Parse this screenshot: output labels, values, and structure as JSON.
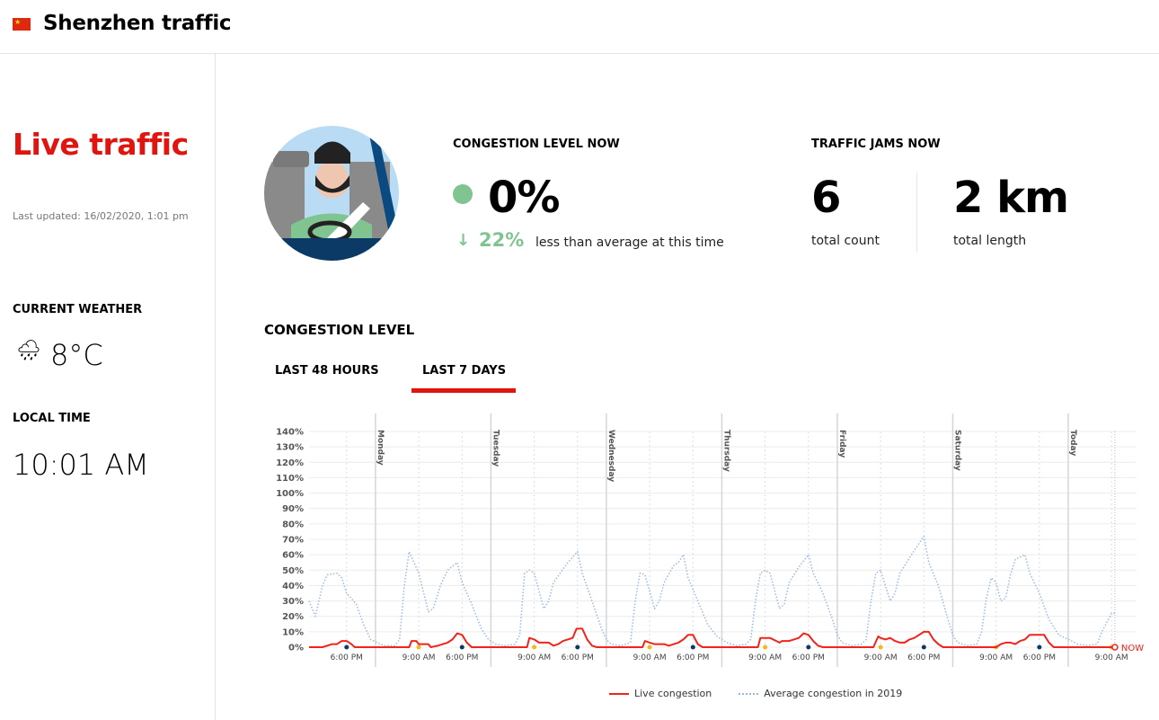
{
  "header": {
    "title": "Shenzhen traffic",
    "flag": "china-flag"
  },
  "sidebar": {
    "live_title": "Live traffic",
    "last_updated": "Last updated: 16/02/2020, 1:01 pm",
    "weather_heading": "CURRENT WEATHER",
    "weather_icon": "rain-cloud-icon",
    "temperature": "8°C",
    "time_heading": "LOCAL TIME",
    "local_time": "10:01 AM"
  },
  "congestion_now": {
    "heading": "CONGESTION LEVEL NOW",
    "value": "0%",
    "status_color": "#7fc491",
    "change": "22%",
    "change_text": "less than average at this time"
  },
  "jams_now": {
    "heading": "TRAFFIC JAMS NOW",
    "count": "6",
    "count_label": "total count",
    "length": "2 km",
    "length_label": "total length"
  },
  "chart_section": {
    "heading": "CONGESTION LEVEL",
    "tabs": [
      {
        "label": "LAST 48 HOURS",
        "active": false
      },
      {
        "label": "LAST 7 DAYS",
        "active": true
      }
    ],
    "accent": "#e0150f"
  },
  "chart_data": {
    "type": "line",
    "x_unit": "hours since Sunday 00:00",
    "xlim": [
      10.2,
      182.2
    ],
    "ylim": [
      0,
      140
    ],
    "yticks": [
      0,
      10,
      20,
      30,
      40,
      50,
      60,
      70,
      80,
      90,
      100,
      110,
      120,
      130,
      140
    ],
    "ytick_labels": [
      "0%",
      "10%",
      "20%",
      "30%",
      "40%",
      "50%",
      "60%",
      "70%",
      "80%",
      "90%",
      "100%",
      "110%",
      "120%",
      "130%",
      "140%"
    ],
    "day_markers": [
      {
        "label": "Monday",
        "x": 24
      },
      {
        "label": "Tuesday",
        "x": 48
      },
      {
        "label": "Wednesday",
        "x": 72
      },
      {
        "label": "Thursday",
        "x": 96
      },
      {
        "label": "Friday",
        "x": 120
      },
      {
        "label": "Saturday",
        "x": 144
      },
      {
        "label": "Today",
        "x": 168
      }
    ],
    "xticks": [
      {
        "label": "6:00 PM",
        "x": 18,
        "dot": "#0b3a66"
      },
      {
        "label": "9:00 AM",
        "x": 33,
        "dot": "#f5b81a"
      },
      {
        "label": "6:00 PM",
        "x": 42,
        "dot": "#0b3a66"
      },
      {
        "label": "9:00 AM",
        "x": 57,
        "dot": "#f5b81a"
      },
      {
        "label": "6:00 PM",
        "x": 66,
        "dot": "#0b3a66"
      },
      {
        "label": "9:00 AM",
        "x": 81,
        "dot": "#f5b81a"
      },
      {
        "label": "6:00 PM",
        "x": 90,
        "dot": "#0b3a66"
      },
      {
        "label": "9:00 AM",
        "x": 105,
        "dot": "#f5b81a"
      },
      {
        "label": "6:00 PM",
        "x": 114,
        "dot": "#0b3a66"
      },
      {
        "label": "9:00 AM",
        "x": 129,
        "dot": "#f5b81a"
      },
      {
        "label": "6:00 PM",
        "x": 138,
        "dot": "#0b3a66"
      },
      {
        "label": "9:00 AM",
        "x": 153,
        "dot": "#f5b81a"
      },
      {
        "label": "6:00 PM",
        "x": 162,
        "dot": "#0b3a66"
      },
      {
        "label": "9:00 AM",
        "x": 177,
        "dot": "#f5b81a"
      }
    ],
    "now": {
      "label": "NOW",
      "x": 177.7,
      "y": 0
    },
    "series": [
      {
        "name": "Live congestion",
        "color": "#f2231b",
        "style": "solid",
        "points": [
          [
            10.2,
            0
          ],
          [
            13,
            0
          ],
          [
            15,
            2
          ],
          [
            16,
            2
          ],
          [
            17,
            4
          ],
          [
            18,
            4
          ],
          [
            19,
            2
          ],
          [
            19.7,
            0
          ],
          [
            31,
            0
          ],
          [
            31.5,
            4
          ],
          [
            32.5,
            4
          ],
          [
            33,
            2
          ],
          [
            35,
            2
          ],
          [
            35.5,
            0
          ],
          [
            37,
            1
          ],
          [
            39,
            3
          ],
          [
            40,
            5
          ],
          [
            41,
            9
          ],
          [
            42,
            8
          ],
          [
            43,
            3
          ],
          [
            44,
            0
          ],
          [
            55.5,
            0
          ],
          [
            56,
            6
          ],
          [
            57,
            5
          ],
          [
            58,
            3
          ],
          [
            60,
            3
          ],
          [
            61,
            1
          ],
          [
            62,
            2
          ],
          [
            63,
            4
          ],
          [
            65,
            6
          ],
          [
            65.8,
            12
          ],
          [
            67,
            12
          ],
          [
            68,
            5
          ],
          [
            69,
            1
          ],
          [
            70,
            0
          ],
          [
            79.5,
            0
          ],
          [
            80,
            4
          ],
          [
            81,
            3
          ],
          [
            82,
            2
          ],
          [
            84,
            2
          ],
          [
            85,
            1
          ],
          [
            87,
            3
          ],
          [
            88,
            5
          ],
          [
            89,
            8
          ],
          [
            90,
            8
          ],
          [
            91,
            2
          ],
          [
            92,
            0
          ],
          [
            103.5,
            0
          ],
          [
            104,
            6
          ],
          [
            106,
            6
          ],
          [
            108,
            3
          ],
          [
            108.5,
            4
          ],
          [
            110,
            4
          ],
          [
            112,
            6
          ],
          [
            113,
            9
          ],
          [
            114,
            8
          ],
          [
            115,
            4
          ],
          [
            116,
            1
          ],
          [
            117,
            0
          ],
          [
            127.5,
            0
          ],
          [
            128.5,
            7
          ],
          [
            129,
            6
          ],
          [
            130,
            5
          ],
          [
            131,
            6
          ],
          [
            132,
            4
          ],
          [
            133,
            3
          ],
          [
            134,
            3
          ],
          [
            135,
            5
          ],
          [
            136,
            6
          ],
          [
            137,
            8
          ],
          [
            138,
            10
          ],
          [
            139,
            10
          ],
          [
            140,
            5
          ],
          [
            141,
            2
          ],
          [
            142,
            0
          ],
          [
            153,
            0
          ],
          [
            154,
            2
          ],
          [
            155,
            3
          ],
          [
            156,
            3
          ],
          [
            157,
            2
          ],
          [
            158,
            4
          ],
          [
            159,
            5
          ],
          [
            160,
            8
          ],
          [
            161,
            8
          ],
          [
            162,
            8
          ],
          [
            163,
            8
          ],
          [
            164,
            3
          ],
          [
            165,
            0
          ],
          [
            177.7,
            0
          ]
        ]
      },
      {
        "name": "Average congestion in 2019",
        "color": "#9ab8e0",
        "style": "dotted",
        "points": [
          [
            10.2,
            30
          ],
          [
            11.5,
            20
          ],
          [
            13,
            40
          ],
          [
            14,
            47
          ],
          [
            16,
            48
          ],
          [
            17,
            45
          ],
          [
            18,
            35
          ],
          [
            20,
            28
          ],
          [
            21.5,
            15
          ],
          [
            23,
            5
          ],
          [
            25,
            2
          ],
          [
            26,
            1
          ],
          [
            28,
            1
          ],
          [
            29,
            5
          ],
          [
            30,
            40
          ],
          [
            31,
            62
          ],
          [
            33,
            48
          ],
          [
            35,
            23
          ],
          [
            36,
            25
          ],
          [
            37.5,
            40
          ],
          [
            39,
            50
          ],
          [
            41,
            55
          ],
          [
            42,
            42
          ],
          [
            44,
            28
          ],
          [
            46,
            12
          ],
          [
            47.5,
            5
          ],
          [
            49,
            2
          ],
          [
            51,
            1
          ],
          [
            53,
            2
          ],
          [
            54,
            8
          ],
          [
            55,
            48
          ],
          [
            56,
            50
          ],
          [
            57,
            48
          ],
          [
            59,
            25
          ],
          [
            60,
            30
          ],
          [
            61,
            42
          ],
          [
            64,
            55
          ],
          [
            66,
            62
          ],
          [
            67,
            48
          ],
          [
            69,
            30
          ],
          [
            71,
            12
          ],
          [
            72,
            5
          ],
          [
            73,
            2
          ],
          [
            75,
            1
          ],
          [
            77,
            3
          ],
          [
            78,
            30
          ],
          [
            79,
            48
          ],
          [
            80,
            47
          ],
          [
            82,
            25
          ],
          [
            83,
            30
          ],
          [
            84,
            42
          ],
          [
            86,
            53
          ],
          [
            87,
            55
          ],
          [
            88,
            60
          ],
          [
            89,
            45
          ],
          [
            91,
            30
          ],
          [
            93,
            15
          ],
          [
            95,
            7
          ],
          [
            97,
            3
          ],
          [
            99,
            1
          ],
          [
            101,
            2
          ],
          [
            102,
            5
          ],
          [
            103,
            30
          ],
          [
            104,
            48
          ],
          [
            105,
            50
          ],
          [
            106,
            48
          ],
          [
            108,
            25
          ],
          [
            109,
            28
          ],
          [
            110,
            42
          ],
          [
            112,
            52
          ],
          [
            114,
            60
          ],
          [
            115,
            48
          ],
          [
            117,
            35
          ],
          [
            119,
            18
          ],
          [
            120,
            8
          ],
          [
            121,
            3
          ],
          [
            123,
            1
          ],
          [
            125,
            2
          ],
          [
            126,
            5
          ],
          [
            127,
            30
          ],
          [
            128,
            48
          ],
          [
            129,
            50
          ],
          [
            131,
            30
          ],
          [
            132,
            35
          ],
          [
            133,
            48
          ],
          [
            135,
            58
          ],
          [
            138,
            72
          ],
          [
            139,
            55
          ],
          [
            141,
            40
          ],
          [
            143,
            18
          ],
          [
            144,
            8
          ],
          [
            145,
            3
          ],
          [
            147,
            1
          ],
          [
            149,
            2
          ],
          [
            150,
            10
          ],
          [
            151,
            32
          ],
          [
            152,
            45
          ],
          [
            153,
            42
          ],
          [
            154,
            30
          ],
          [
            155,
            32
          ],
          [
            156,
            47
          ],
          [
            157,
            57
          ],
          [
            159,
            60
          ],
          [
            160,
            48
          ],
          [
            162,
            35
          ],
          [
            164,
            18
          ],
          [
            166,
            8
          ],
          [
            168,
            5
          ],
          [
            170,
            2
          ],
          [
            172,
            1
          ],
          [
            174,
            2
          ],
          [
            175,
            10
          ],
          [
            177,
            22
          ],
          [
            177.7,
            22
          ]
        ]
      }
    ],
    "legend": [
      "Live congestion",
      "Average congestion in 2019"
    ],
    "legend_position": "bottom-center"
  }
}
